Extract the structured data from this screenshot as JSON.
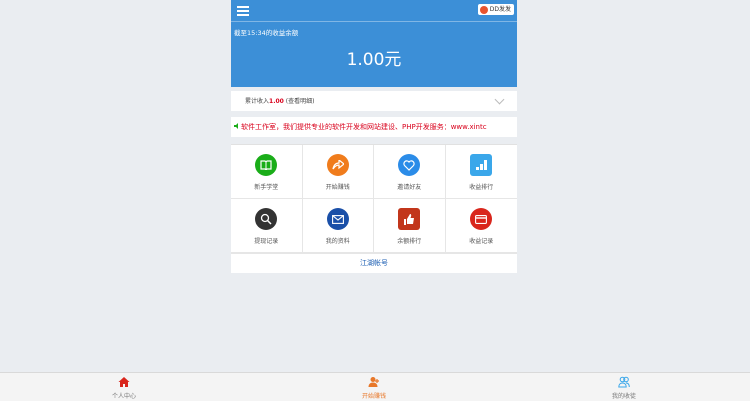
{
  "header": {
    "user_label": "DD发发",
    "title": "截至15:34的收益余额",
    "amount": "1.00元"
  },
  "summary": {
    "prefix": "累计收入",
    "value": "1.00",
    "suffix": "(查看明细)"
  },
  "notice": {
    "text": "软件工作室，我们提供专业的软件开发和网站建设、PHP开发服务：www.xintc"
  },
  "grid": {
    "items": [
      {
        "label": "新手学堂",
        "icon": "book-icon",
        "color": "#1aad19"
      },
      {
        "label": "开始赚钱",
        "icon": "share-arrow-icon",
        "color": "#f07c1c"
      },
      {
        "label": "邀请好友",
        "icon": "heart-icon",
        "color": "#2b8ce8"
      },
      {
        "label": "收益排行",
        "icon": "chart-icon",
        "color": "#3aa7ea"
      },
      {
        "label": "提现记录",
        "icon": "search-icon",
        "color": "#333333"
      },
      {
        "label": "我的资料",
        "icon": "mail-icon",
        "color": "#1a4fa8"
      },
      {
        "label": "余额排行",
        "icon": "thumbs-up-icon",
        "color": "#c2361b"
      },
      {
        "label": "收益记录",
        "icon": "card-icon",
        "color": "#d9261c"
      }
    ]
  },
  "footer_link": "江湖帐号",
  "tabbar": {
    "items": [
      {
        "label": "个人中心",
        "icon": "home-icon",
        "color": "#d9261c"
      },
      {
        "label": "开始赚钱",
        "icon": "user-add-icon",
        "color": "#e8782a"
      },
      {
        "label": "我的收徒",
        "icon": "users-icon",
        "color": "#3aa7ea"
      }
    ]
  }
}
